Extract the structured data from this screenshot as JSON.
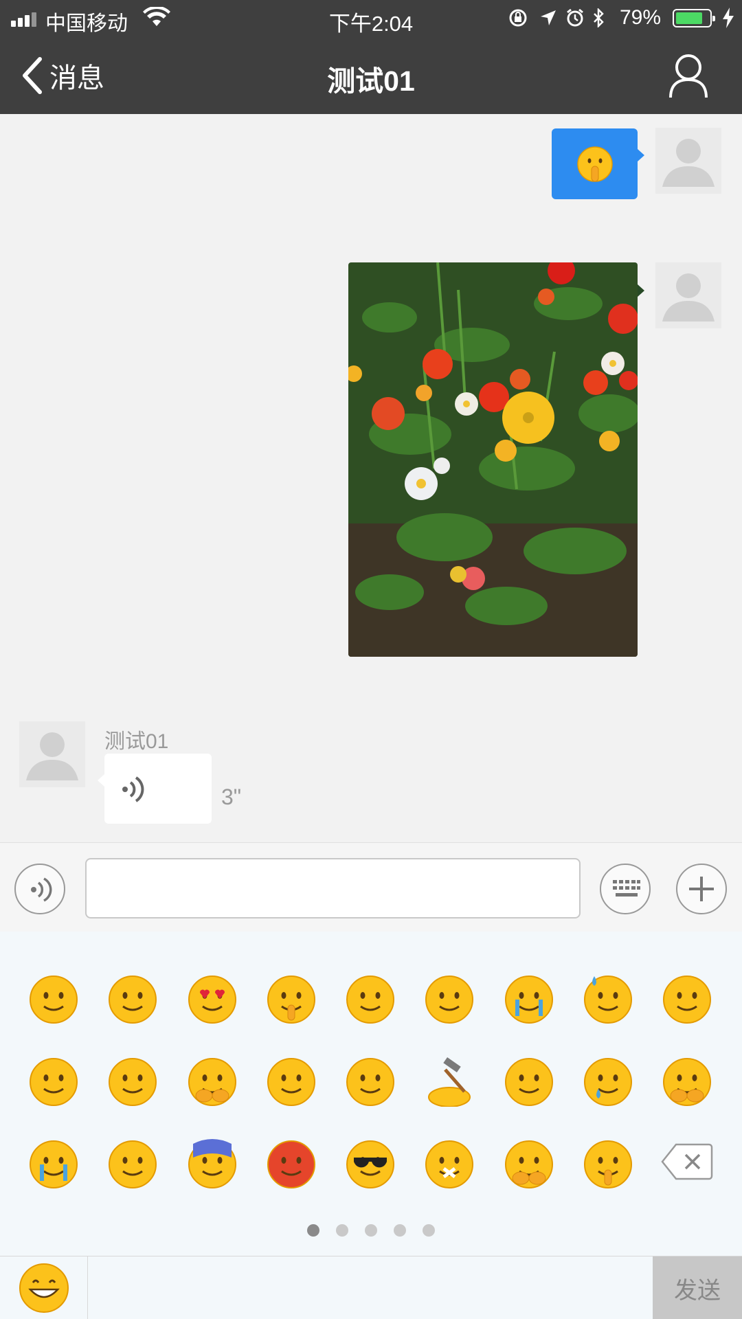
{
  "status_bar": {
    "carrier": "中国移动",
    "time": "下午2:04",
    "battery_percent": "79%",
    "battery_level": 0.79,
    "icons": [
      "signal-icon",
      "wifi-icon",
      "orientation-lock-icon",
      "location-icon",
      "alarm-icon",
      "bluetooth-icon",
      "battery-icon",
      "charging-icon"
    ]
  },
  "nav": {
    "back_label": "消息",
    "title": "测试01",
    "right_icon": "person-icon"
  },
  "messages": {
    "sent_emoji": {
      "icon": "shush-emoji"
    },
    "sent_photo": {
      "icon": "flower-photo"
    },
    "received_voice": {
      "sender_name": "测试01",
      "duration": "3\"",
      "icon": "voice-wave-icon"
    }
  },
  "input_bar": {
    "text_value": "",
    "left_icon": "voice-icon",
    "keyboard_icon": "keyboard-icon",
    "plus_icon": "plus-icon"
  },
  "emoji_panel": {
    "page_count": 5,
    "active_page": 1,
    "emojis": [
      "smile",
      "grin",
      "heart-eyes",
      "shush",
      "kiss",
      "flushed",
      "tears-of-joy",
      "sweat",
      "grimace",
      "tongue-wink",
      "relieved",
      "shy",
      "wink",
      "pleading",
      "hammer-head",
      "surprised",
      "sad-tear",
      "covering-mouth",
      "loud-cry",
      "yelling",
      "scream",
      "angry",
      "sunglasses",
      "zipped",
      "fists",
      "thinking"
    ],
    "delete_icon": "backspace-icon"
  },
  "bottom_bar": {
    "emoji_tab_icon": "grin-emoji",
    "send_label": "发送"
  },
  "colors": {
    "nav_bg": "#3f3f3f",
    "chat_bg": "#f2f2f2",
    "sent_bubble": "#2d8cf0",
    "emoji_panel_bg": "#f3f8fb",
    "send_btn_bg": "#c7c7c7"
  }
}
